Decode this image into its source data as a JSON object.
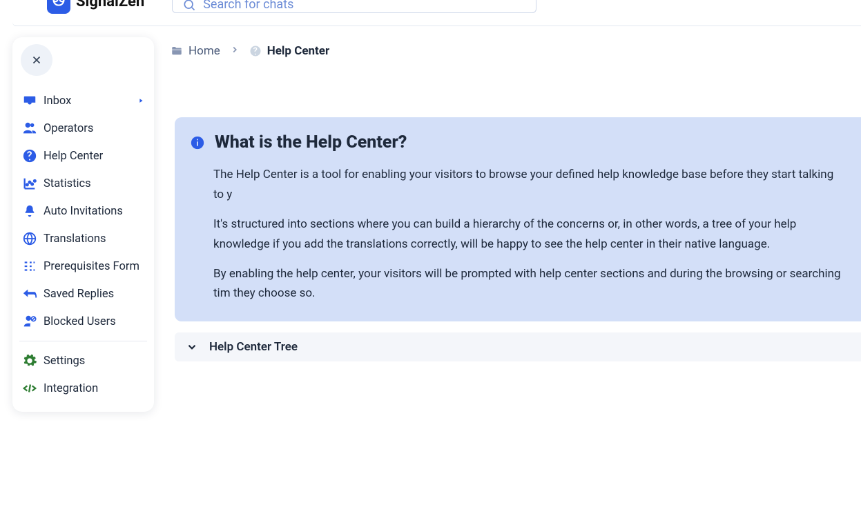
{
  "app": {
    "name": "SignalZen"
  },
  "search": {
    "placeholder": "Search for chats"
  },
  "sidebar": {
    "items": [
      {
        "id": "inbox",
        "label": "Inbox",
        "has_caret": true
      },
      {
        "id": "operators",
        "label": "Operators"
      },
      {
        "id": "help-center",
        "label": "Help Center"
      },
      {
        "id": "statistics",
        "label": "Statistics"
      },
      {
        "id": "auto-invitations",
        "label": "Auto Invitations"
      },
      {
        "id": "translations",
        "label": "Translations"
      },
      {
        "id": "prerequisites-form",
        "label": "Prerequisites Form"
      },
      {
        "id": "saved-replies",
        "label": "Saved Replies"
      },
      {
        "id": "blocked-users",
        "label": "Blocked Users"
      }
    ],
    "bottom": [
      {
        "id": "settings",
        "label": "Settings"
      },
      {
        "id": "integration",
        "label": "Integration"
      }
    ]
  },
  "breadcrumbs": {
    "home": "Home",
    "current": "Help Center"
  },
  "info": {
    "title": "What is the Help Center?",
    "p1": "The Help Center is a tool for enabling your visitors to browse your defined help knowledge base before they start talking to y",
    "p2": "It's structured into sections where you can build a hierarchy of the concerns or, in other words, a tree of your help knowledge if you add the translations correctly, will be happy to see the help center in their native language.",
    "p3": "By enabling the help center, your visitors will be prompted with help center sections and during the browsing or searching tim they choose so."
  },
  "tree": {
    "title": "Help Center Tree"
  }
}
